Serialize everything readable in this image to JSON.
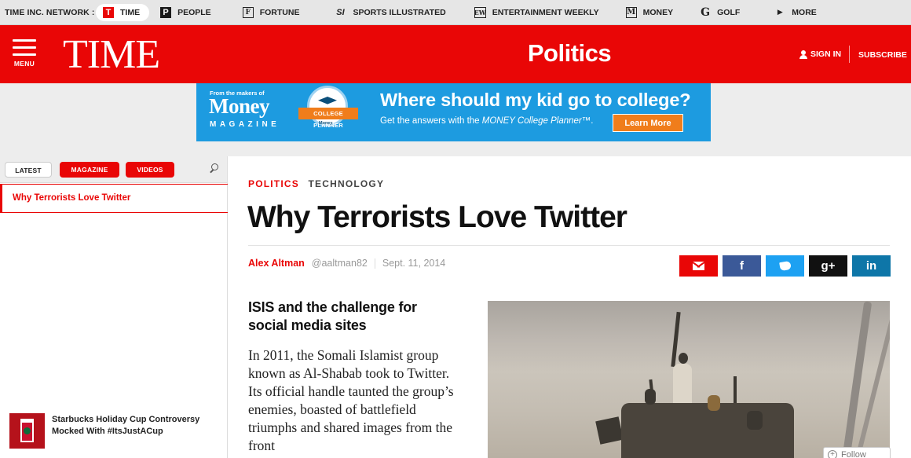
{
  "network": {
    "label": "TIME INC. NETWORK :",
    "items": [
      {
        "label": "TIME",
        "logo": "T",
        "active": true
      },
      {
        "label": "PEOPLE",
        "logo": "P"
      },
      {
        "label": "FORTUNE",
        "logo": "F"
      },
      {
        "label": "SPORTS ILLUSTRATED",
        "logo": "SI"
      },
      {
        "label": "ENTERTAINMENT WEEKLY",
        "logo": "EW"
      },
      {
        "label": "MONEY",
        "logo": "M"
      },
      {
        "label": "GOLF",
        "logo": "G"
      },
      {
        "label": "MORE",
        "logo": "▶"
      }
    ]
  },
  "header": {
    "menu_label": "MENU",
    "logo": "TIME",
    "section": "Politics",
    "sign_in": "SIGN IN",
    "subscribe": "SUBSCRIBE",
    "accent_color": "#e90606"
  },
  "ad": {
    "from": "From the makers of",
    "brand": "Money",
    "brand_sub": "MAGAZINE",
    "badge": "COLLEGE PLANNER",
    "badge_sub": "Money",
    "headline": "Where should my kid go to college?",
    "sub_prefix": "Get the answers with the ",
    "sub_italic": "MONEY College Planner",
    "sub_suffix": "™.",
    "cta": "Learn More"
  },
  "sidebar": {
    "tabs": {
      "latest": "LATEST",
      "magazine": "MAGAZINE",
      "videos": "VIDEOS"
    },
    "active_story": "Why Terrorists Love Twitter",
    "story_title": "Starbucks Holiday Cup Controversy Mocked With #ItsJustACup"
  },
  "article": {
    "tags": [
      "POLITICS",
      "TECHNOLOGY"
    ],
    "title": "Why Terrorists Love Twitter",
    "author": "Alex Altman",
    "handle": "@aaltman82",
    "date": "Sept. 11, 2014",
    "dek": "ISIS and the challenge for social media sites",
    "body": "In 2011, the Somali Islamist group known as Al-Shabab took to Twitter. Its official handle taunted the group’s enemies, boasted of battlefield triumphs and shared images from the front",
    "share": {
      "email": "email-icon",
      "facebook": "f",
      "twitter": "twitter-icon",
      "gplus": "g+",
      "linkedin": "in"
    },
    "follow": "Follow"
  }
}
